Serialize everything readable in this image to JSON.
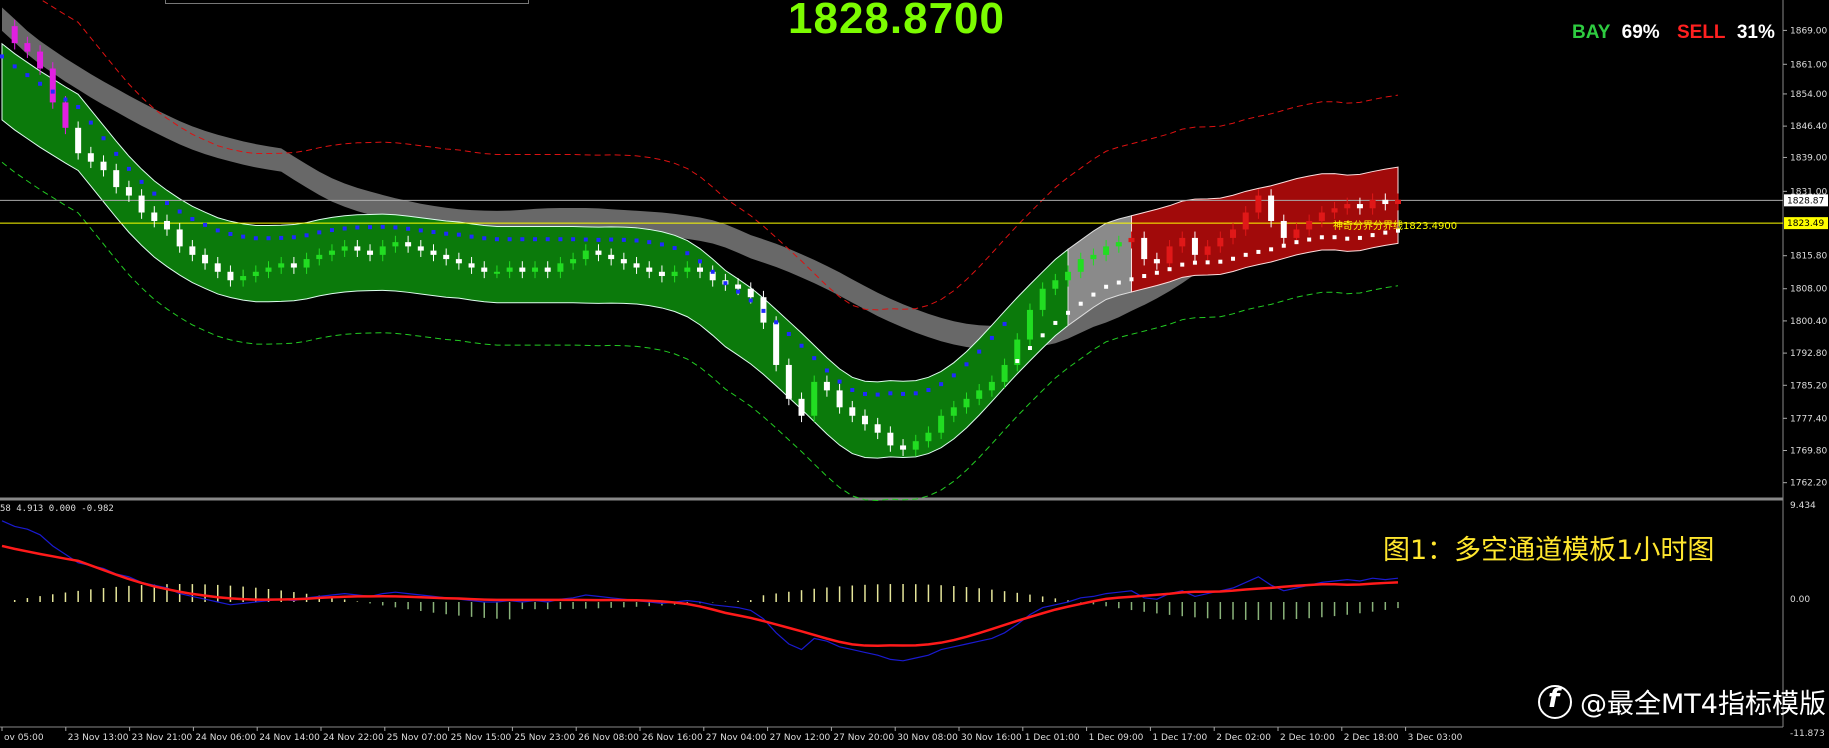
{
  "header": {
    "current_price": "1828.8700",
    "buy_label": "BAY",
    "buy_pct": "69%",
    "sell_label": "SELL",
    "sell_pct": "31%"
  },
  "colors": {
    "background": "#000000",
    "price_text": "#7CFC00",
    "buy": "#2ECC40",
    "sell": "#FF2020",
    "green_channel": "#0B7A0B",
    "red_channel": "#A10A0A",
    "gray_band": "#7a7a7a",
    "signal_line": "#FF1A1A",
    "macd_line": "#1A1AD0",
    "support_line": "#FFFF00",
    "caption": "#FFE62E"
  },
  "price_axis": {
    "ticks": [
      "1869.00",
      "1861.00",
      "1854.00",
      "1846.40",
      "1839.00",
      "1831.00",
      "1815.80",
      "1808.00",
      "1800.40",
      "1792.80",
      "1785.20",
      "1777.40",
      "1769.80",
      "1762.20"
    ],
    "current_tag": "1828.87",
    "level_tag": "1823.49"
  },
  "level_annotation": "神奇分界分界线1823.4900",
  "indicator": {
    "params": "58 4.913 0.000 -0.982",
    "ticks": [
      "9.434",
      "0.00",
      "-11.873"
    ]
  },
  "time_axis": [
    "ov 05:00",
    "23 Nov 13:00",
    "23 Nov 21:00",
    "24 Nov 06:00",
    "24 Nov 14:00",
    "24 Nov 22:00",
    "25 Nov 07:00",
    "25 Nov 15:00",
    "25 Nov 23:00",
    "26 Nov 08:00",
    "26 Nov 16:00",
    "27 Nov 04:00",
    "27 Nov 12:00",
    "27 Nov 20:00",
    "30 Nov 08:00",
    "30 Nov 16:00",
    "1 Dec 01:00",
    "1 Dec 09:00",
    "1 Dec 17:00",
    "2 Dec 02:00",
    "2 Dec 10:00",
    "2 Dec 18:00",
    "3 Dec 03:00"
  ],
  "caption": "图1：多空通道模板1小时图",
  "watermark": "@最全MT4指标模版",
  "chart_data": {
    "type": "line",
    "title": "",
    "ylim": [
      1760,
      1875
    ],
    "close_series": [
      1870,
      1866,
      1864,
      1860,
      1852,
      1846,
      1840,
      1838,
      1836,
      1832,
      1830,
      1826,
      1824,
      1822,
      1818,
      1816,
      1814,
      1812,
      1810,
      1811,
      1812,
      1813,
      1814,
      1813,
      1815,
      1816,
      1817,
      1818,
      1817,
      1816,
      1818,
      1819,
      1818,
      1817,
      1816,
      1815,
      1814,
      1813,
      1812,
      1812,
      1813,
      1812,
      1813,
      1812,
      1814,
      1815,
      1817,
      1816,
      1815,
      1814,
      1813,
      1812,
      1811,
      1812,
      1813,
      1812,
      1810,
      1809,
      1808,
      1806,
      1800,
      1790,
      1782,
      1778,
      1786,
      1784,
      1780,
      1778,
      1776,
      1774,
      1771,
      1770,
      1772,
      1774,
      1778,
      1780,
      1782,
      1784,
      1786,
      1790,
      1796,
      1803,
      1808,
      1810,
      1812,
      1815,
      1816,
      1818,
      1819,
      1820,
      1815,
      1814,
      1818,
      1820,
      1816,
      1818,
      1820,
      1822,
      1826,
      1830,
      1824,
      1820,
      1822,
      1824,
      1826,
      1827,
      1828,
      1827,
      1829,
      1828,
      1829
    ]
  }
}
